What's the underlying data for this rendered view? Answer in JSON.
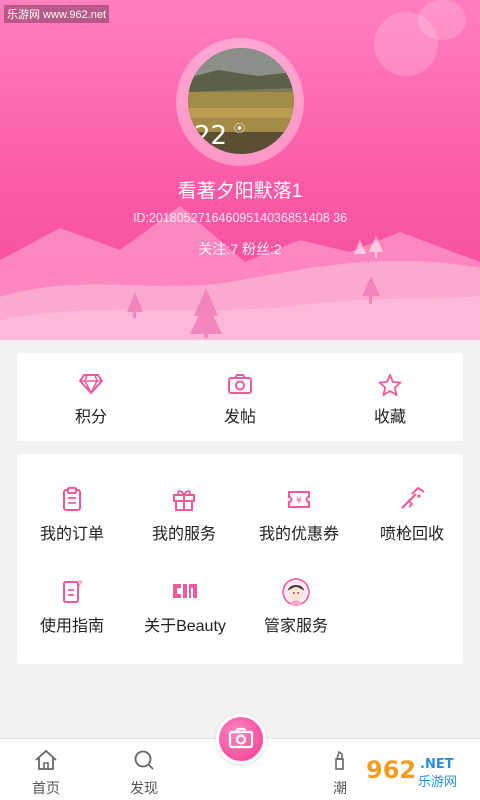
{
  "watermark_top": "乐游网 www.962.net",
  "profile": {
    "username": "看著夕阳默落1",
    "user_id": "ID:20180527164609514036851408 36",
    "follow_text": "关注:7 粉丝:2"
  },
  "quick_actions": [
    {
      "label": "积分",
      "icon": "diamond-icon"
    },
    {
      "label": "发帖",
      "icon": "camera-icon"
    },
    {
      "label": "收藏",
      "icon": "star-icon"
    }
  ],
  "menu_items": [
    {
      "label": "我的订单",
      "icon": "clipboard-icon"
    },
    {
      "label": "我的服务",
      "icon": "gift-icon"
    },
    {
      "label": "我的优惠券",
      "icon": "coupon-icon"
    },
    {
      "label": "喷枪回收",
      "icon": "spray-gun-icon"
    },
    {
      "label": "使用指南",
      "icon": "guide-icon"
    },
    {
      "label": "关于Beauty",
      "icon": "brand-logo-icon"
    },
    {
      "label": "管家服务",
      "icon": "butler-avatar-icon"
    }
  ],
  "tabbar": {
    "items": [
      {
        "label": "首页",
        "icon": "home-icon"
      },
      {
        "label": "发现",
        "icon": "search-icon"
      },
      {
        "label": "潮",
        "icon": "lipstick-icon"
      }
    ]
  },
  "watermark_bottom": {
    "badge": "962",
    "site": "乐游网",
    "net": ".NET"
  },
  "colors": {
    "accent": "#f44c9b",
    "icon_pink": "#ef5a9d",
    "header_top": "#ff7fbf"
  }
}
